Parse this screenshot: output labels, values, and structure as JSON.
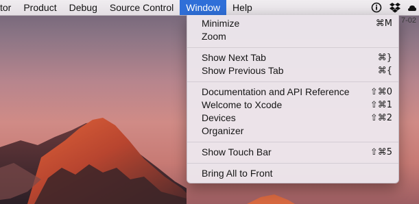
{
  "menubar": {
    "items": [
      "tor",
      "Product",
      "Debug",
      "Source Control",
      "Window",
      "Help"
    ],
    "active": "Window"
  },
  "status_icons": [
    "info-icon",
    "dropbox-icon",
    "cloud-icon"
  ],
  "window_menu": {
    "groups": [
      [
        {
          "label": "Minimize",
          "shortcut": "⌘M"
        },
        {
          "label": "Zoom",
          "shortcut": ""
        }
      ],
      [
        {
          "label": "Show Next Tab",
          "shortcut": "⌘}"
        },
        {
          "label": "Show Previous Tab",
          "shortcut": "⌘{"
        }
      ],
      [
        {
          "label": "Documentation and API Reference",
          "shortcut": "⇧⌘0"
        },
        {
          "label": "Welcome to Xcode",
          "shortcut": "⇧⌘1"
        },
        {
          "label": "Devices",
          "shortcut": "⇧⌘2"
        },
        {
          "label": "Organizer",
          "shortcut": ""
        }
      ],
      [
        {
          "label": "Show Touch Bar",
          "shortcut": "⇧⌘5"
        }
      ],
      [
        {
          "label": "Bring All to Front",
          "shortcut": ""
        }
      ]
    ]
  },
  "desktop": {
    "corner_text": "7-02"
  },
  "colors": {
    "menu_highlight": "#2f6fd8"
  }
}
